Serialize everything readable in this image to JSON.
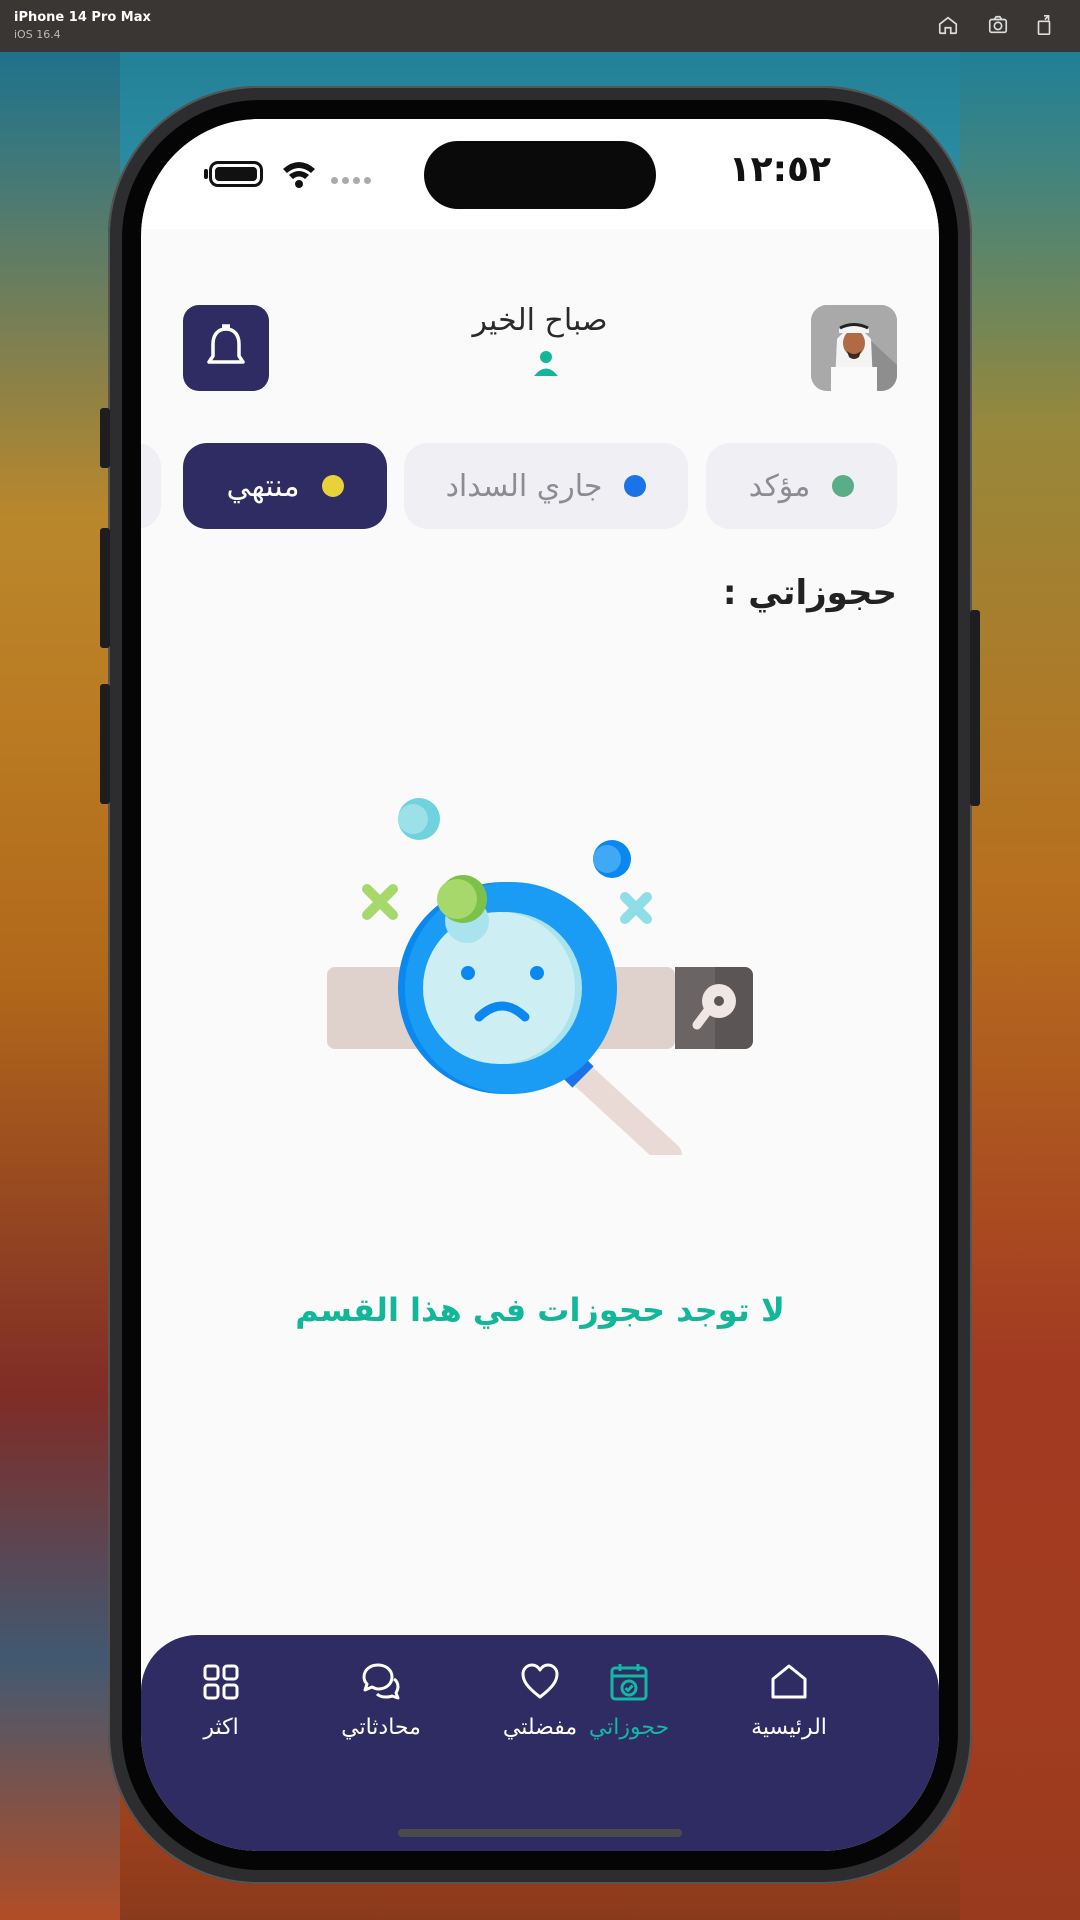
{
  "simulator": {
    "device_name": "iPhone 14 Pro Max",
    "os_version": "iOS 16.4"
  },
  "status_bar": {
    "time": "١٢:٥٢"
  },
  "header": {
    "greeting": "صباح الخير"
  },
  "tabs": [
    {
      "label": "مؤكد",
      "dot_color": "#5aae87",
      "active": false
    },
    {
      "label": "جاري السداد",
      "dot_color": "#1a73e8",
      "active": false
    },
    {
      "label": "منتهي",
      "dot_color": "#e8d23a",
      "active": true
    }
  ],
  "section": {
    "title": "حجوزاتي :"
  },
  "empty_state": {
    "message": "لا توجد حجوزات في هذا القسم",
    "illustration": "magnifier-sad-face"
  },
  "bottom_nav": [
    {
      "label": "الرئيسية",
      "icon": "home-icon",
      "active": false
    },
    {
      "label": "حجوزاتي",
      "icon": "calendar-check-icon",
      "active": true
    },
    {
      "label": "مفضلتي",
      "icon": "heart-icon",
      "active": false
    },
    {
      "label": "محادثاتي",
      "icon": "chat-icon",
      "active": false
    },
    {
      "label": "اكثر",
      "icon": "grid-icon",
      "active": false
    }
  ],
  "colors": {
    "primary": "#2f2b63",
    "accent": "#12b79a",
    "screen_bg": "#fafafa"
  }
}
